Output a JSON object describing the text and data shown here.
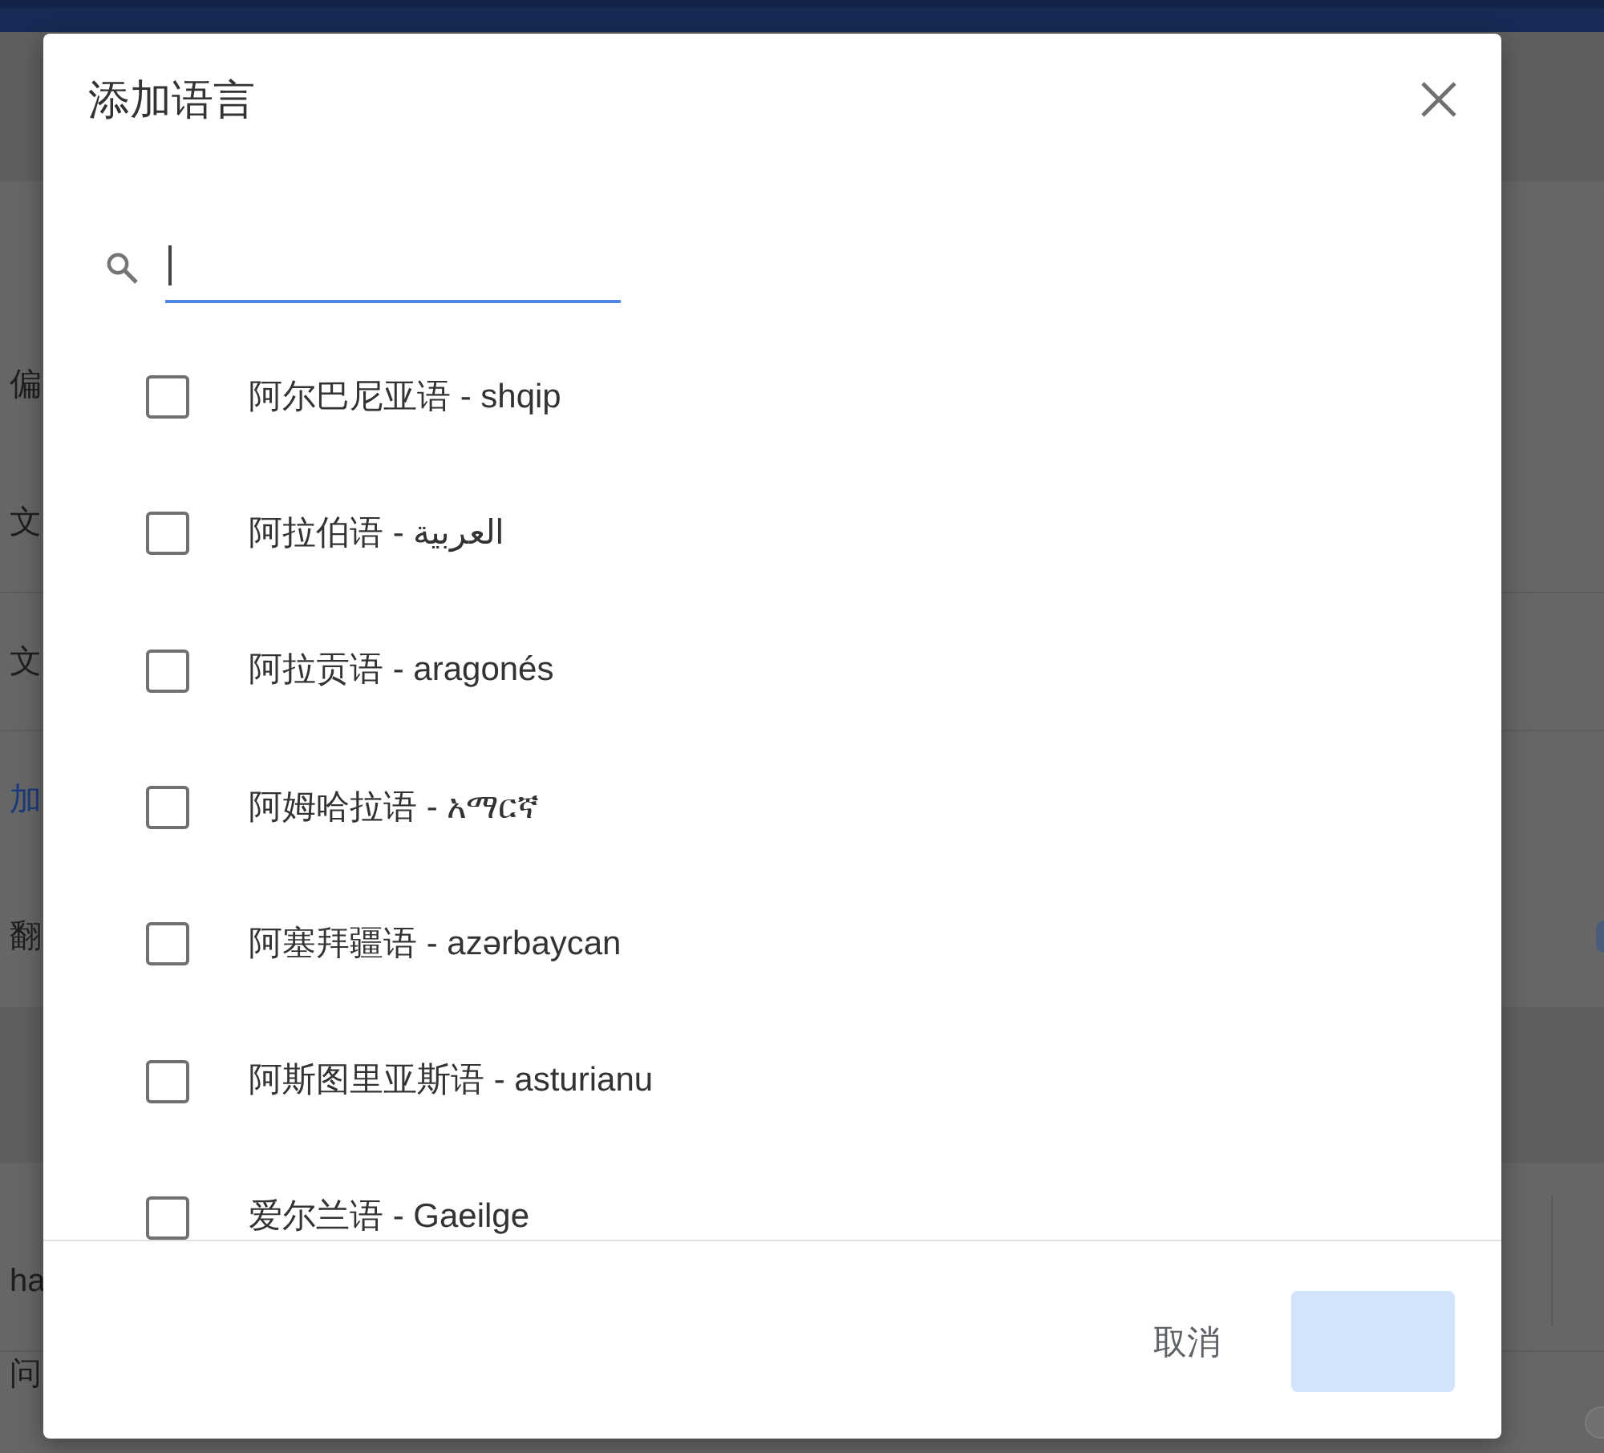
{
  "background_page": {
    "sections": [
      {
        "rows": [
          {
            "kind": "label",
            "text": "偏"
          },
          {
            "kind": "label",
            "text": "文"
          },
          {
            "kind": "label",
            "text": "文"
          },
          {
            "kind": "link",
            "text": "加"
          },
          {
            "kind": "toggle",
            "text": "翻",
            "on": true
          }
        ]
      },
      {
        "rows": [
          {
            "kind": "label",
            "text": "ha"
          },
          {
            "kind": "toggle",
            "text": "问",
            "on": false
          }
        ]
      }
    ]
  },
  "dialog": {
    "title": "添加语言",
    "search": {
      "focused": true
    },
    "languages": [
      {
        "label": "阿尔巴尼亚语 - shqip",
        "checked": false
      },
      {
        "label": "阿拉伯语 - العربية",
        "checked": false
      },
      {
        "label": "阿拉贡语 - aragonés",
        "checked": false
      },
      {
        "label": "阿姆哈拉语 - አማርኛ",
        "checked": false
      },
      {
        "label": "阿塞拜疆语 - azərbaycan",
        "checked": false
      },
      {
        "label": "阿斯图里亚斯语 - asturianu",
        "checked": false
      },
      {
        "label": "爱尔兰语 - Gaeilge",
        "checked": false
      }
    ],
    "buttons": [
      {
        "kind": "text",
        "label": "取消"
      },
      {
        "kind": "action",
        "disabled": true
      }
    ]
  }
}
